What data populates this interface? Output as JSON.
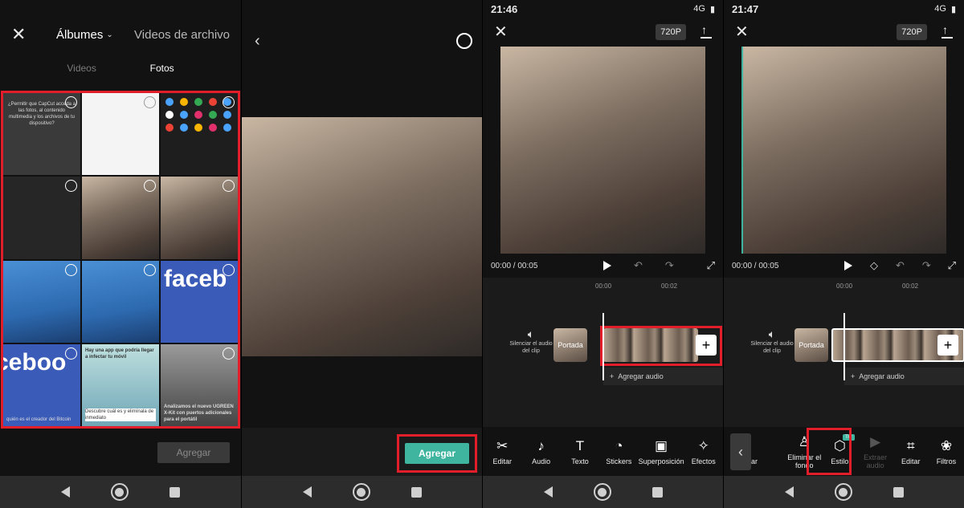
{
  "panel1": {
    "header": {
      "albums_label": "Álbumes",
      "videos_archivo_label": "Videos de archivo"
    },
    "tabs": {
      "videos": "Videos",
      "fotos": "Fotos"
    },
    "thumbs": {
      "t1_text": "¿Permitir que CapCut acceda a las fotos, al contenido multimedia y los archivos de tu dispositivo?",
      "fb_text": "faceb",
      "fb_text2": "ceboo",
      "t8_text": "Hay una app que podría llegar a infectar tu móvil",
      "t8_sub": "Descubre cuál es y elimínala de inmediato",
      "t9_text": "Analizamos el nuevo UGREEN X-Kit con puertos adicionales para el portátil",
      "t7_text": "quién es el creador del Bitcoin"
    },
    "agregar_label": "Agregar"
  },
  "panel2": {
    "agregar_label": "Agregar"
  },
  "panel3": {
    "status": {
      "time": "21:46",
      "network": "4G"
    },
    "resolution": "720P",
    "timecode": "00:00 / 00:05",
    "ticks": [
      "00:00",
      "00:02"
    ],
    "mute_label": "Silenciar el audio del clip",
    "cover_label": "Portada",
    "add_audio_label": "Agregar audio",
    "tools": [
      {
        "icon": "✂",
        "label": "Editar"
      },
      {
        "icon": "♪",
        "label": "Audio"
      },
      {
        "icon": "T",
        "label": "Texto"
      },
      {
        "icon": "◔",
        "label": "Stickers"
      },
      {
        "icon": "▣",
        "label": "Superposición"
      },
      {
        "icon": "✧",
        "label": "Efectos"
      }
    ]
  },
  "panel4": {
    "status": {
      "time": "21:47",
      "network": "4G"
    },
    "resolution": "720P",
    "timecode": "00:00 / 00:05",
    "ticks": [
      "00:00",
      "00:02"
    ],
    "mute_label": "Silenciar el audio del clip",
    "cover_label": "Portada",
    "add_audio_label": "Agregar audio",
    "try_badge": "Try",
    "tools": [
      {
        "icon": "",
        "label": "ar"
      },
      {
        "icon": "♙",
        "label": "Eliminar el fondo"
      },
      {
        "icon": "⬡",
        "label": "Estilo"
      },
      {
        "icon": "▶",
        "label": "Extraer audio"
      },
      {
        "icon": "⌗",
        "label": "Editar"
      },
      {
        "icon": "❀",
        "label": "Filtros"
      }
    ]
  },
  "colors": {
    "accent_red": "#e31e2b",
    "accent_green": "#3fb5a0",
    "background": "#121212"
  }
}
